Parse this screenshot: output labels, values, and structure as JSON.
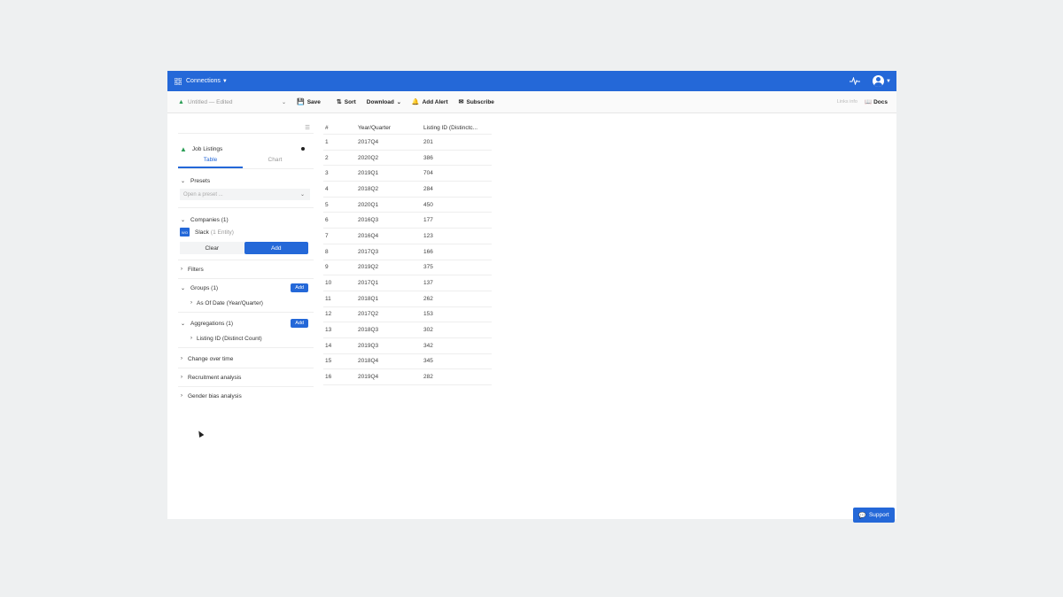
{
  "topbar": {
    "connections_label": "Connections"
  },
  "toolbar": {
    "title": "Untitled",
    "status": "— Edited",
    "save_label": "Save",
    "sort_label": "Sort",
    "download_label": "Download",
    "add_alert_label": "Add Alert",
    "subscribe_label": "Subscribe",
    "hint": "Links info",
    "docs_label": "Docs"
  },
  "sidebar": {
    "dataset_label": "Job Listings",
    "tabs": [
      "Table",
      "Chart"
    ],
    "presets_label": "Presets",
    "preset_placeholder": "Open a preset ...",
    "companies_label": "Companies (1)",
    "company_logo": "WO",
    "company_name": "Slack",
    "company_entity": "(1 Entity)",
    "clear_label": "Clear",
    "add_label": "Add",
    "filters_label": "Filters",
    "groups_label": "Groups (1)",
    "group_item": "As Of Date (Year/Quarter)",
    "aggregations_label": "Aggregations (1)",
    "aggregation_item": "Listing ID (Distinct Count)",
    "change_label": "Change over time",
    "recruitment_label": "Recruitment analysis",
    "gender_label": "Gender bias analysis"
  },
  "table": {
    "headers": [
      "#",
      "Year/Quarter",
      "Listing ID (Distinctc..."
    ],
    "rows": [
      [
        "1",
        "2017Q4",
        "201"
      ],
      [
        "2",
        "2020Q2",
        "386"
      ],
      [
        "3",
        "2019Q1",
        "704"
      ],
      [
        "4",
        "2018Q2",
        "284"
      ],
      [
        "5",
        "2020Q1",
        "450"
      ],
      [
        "6",
        "2016Q3",
        "177"
      ],
      [
        "7",
        "2016Q4",
        "123"
      ],
      [
        "8",
        "2017Q3",
        "166"
      ],
      [
        "9",
        "2019Q2",
        "375"
      ],
      [
        "10",
        "2017Q1",
        "137"
      ],
      [
        "11",
        "2018Q1",
        "262"
      ],
      [
        "12",
        "2017Q2",
        "153"
      ],
      [
        "13",
        "2018Q3",
        "302"
      ],
      [
        "14",
        "2019Q3",
        "342"
      ],
      [
        "15",
        "2018Q4",
        "345"
      ],
      [
        "16",
        "2019Q4",
        "282"
      ]
    ]
  },
  "support_label": "Support",
  "colors": {
    "accent": "#2468d8",
    "success": "#2a9d55"
  }
}
